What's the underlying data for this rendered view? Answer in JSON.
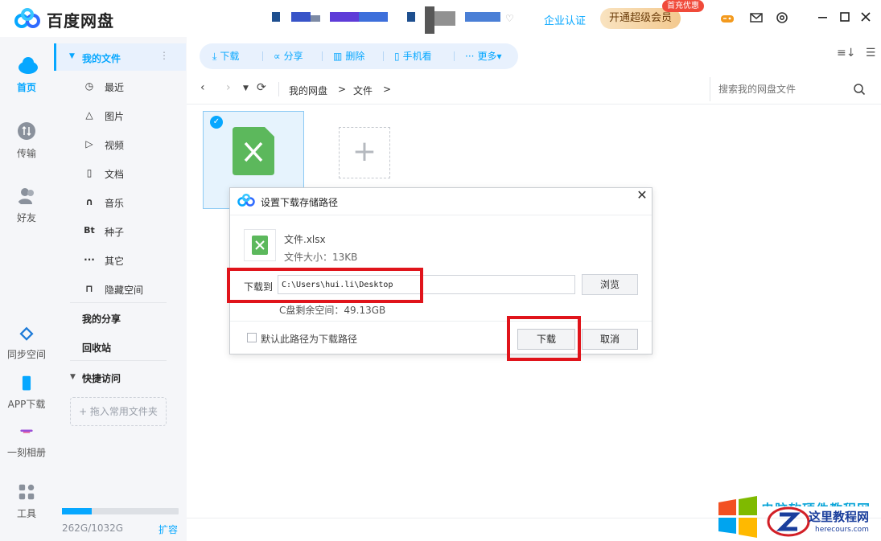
{
  "app": {
    "name": "百度网盘"
  },
  "header": {
    "enterprise_label": "企业认证",
    "vip_button": "开通超级会员",
    "vip_badge": "首充优惠"
  },
  "nav_rail": [
    {
      "label": "首页",
      "icon": "cloud-icon",
      "active": true
    },
    {
      "label": "传输",
      "icon": "transfer-icon"
    },
    {
      "label": "好友",
      "icon": "friends-icon"
    },
    {
      "label": "同步空间",
      "icon": "sync-icon"
    },
    {
      "label": "APP下载",
      "icon": "phone-icon"
    },
    {
      "label": "一刻相册",
      "icon": "album-icon"
    },
    {
      "label": "工具",
      "icon": "tools-icon"
    }
  ],
  "sidebar": {
    "my_files": "我的文件",
    "categories": [
      {
        "label": "最近",
        "icon": "clock-icon",
        "glyph": "◷"
      },
      {
        "label": "图片",
        "icon": "image-icon",
        "glyph": "△"
      },
      {
        "label": "视频",
        "icon": "video-icon",
        "glyph": "▷"
      },
      {
        "label": "文档",
        "icon": "document-icon",
        "glyph": "▯"
      },
      {
        "label": "音乐",
        "icon": "headphones-icon",
        "glyph": "∩"
      },
      {
        "label": "种子",
        "icon": "bt-icon",
        "glyph": "Bt"
      },
      {
        "label": "其它",
        "icon": "more-dots-icon",
        "glyph": "···"
      },
      {
        "label": "隐藏空间",
        "icon": "lock-icon",
        "glyph": "⊓"
      }
    ],
    "my_share": "我的分享",
    "recycle_bin": "回收站",
    "quick_access": "快捷访问",
    "add_folder": "+ 拖入常用文件夹",
    "storage": {
      "used_fraction": 0.254,
      "text": "262G/1032G",
      "expand": "扩容"
    }
  },
  "toolbar": {
    "download": "下载",
    "share": "分享",
    "delete": "删除",
    "phone_view": "手机看",
    "more": "更多▾"
  },
  "breadcrumb": {
    "items": [
      "我的网盘",
      ">",
      "文件",
      ">"
    ],
    "search_placeholder": "搜索我的网盘文件"
  },
  "dialog": {
    "title": "设置下载存储路径",
    "file_name": "文件.xlsx",
    "file_size": "文件大小：13KB",
    "download_to": "下载到",
    "path": "C:\\Users\\hui.li\\Desktop",
    "browse": "浏览",
    "free_space": "C盘剩余空间：49.13GB",
    "default_path_checkbox": "默认此路径为下载路径",
    "download_button": "下载",
    "cancel_button": "取消"
  },
  "watermark": {
    "cn": "这里教程网",
    "url": "herecours.com",
    "top_text": "电脑软硬件教程网"
  },
  "colors": {
    "accent": "#06a7ff",
    "highlight_box": "#e0141b",
    "excel_green": "#5cb85c"
  }
}
